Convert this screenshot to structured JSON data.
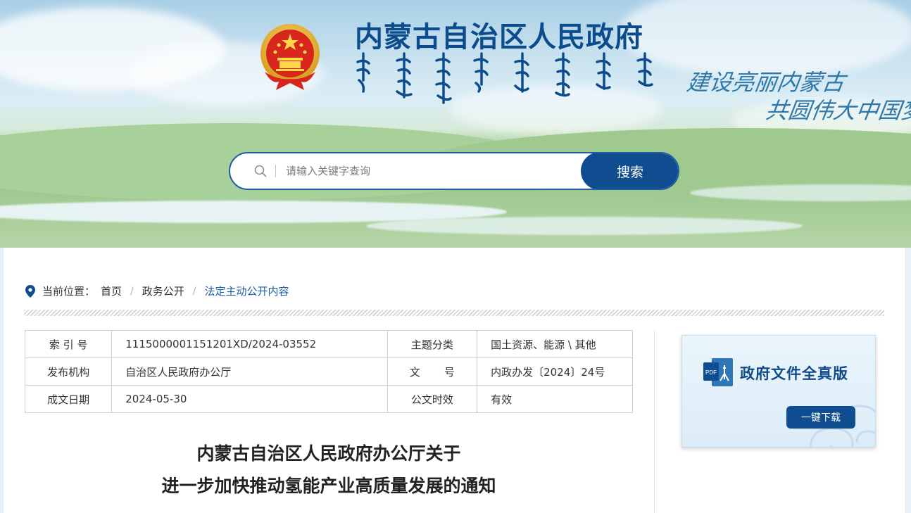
{
  "header": {
    "site_title": "内蒙古自治区人民政府",
    "slogan_line1": "建设亮丽内蒙古",
    "slogan_line2": "共圆伟大中国梦"
  },
  "search": {
    "placeholder": "请输入关键字查询",
    "button_label": "搜索"
  },
  "breadcrumb": {
    "prefix": "当前位置：",
    "items": [
      "首页",
      "政务公开",
      "法定主动公开内容"
    ],
    "separator": "/"
  },
  "meta": {
    "rows": [
      {
        "label1": "索 引 号",
        "value1": "1115000001151201XD/2024-03552",
        "label2": "主题分类",
        "value2": "国土资源、能源 \\ 其他"
      },
      {
        "label1": "发布机构",
        "value1": "自治区人民政府办公厅",
        "label2": "文 号",
        "value2": "内政办发〔2024〕24号"
      },
      {
        "label1": "成文日期",
        "value1": "2024-05-30",
        "label2": "公文时效",
        "value2": "有效"
      }
    ]
  },
  "pdf_panel": {
    "title": "政府文件全真版",
    "download_label": "一键下载"
  },
  "document": {
    "title_line1": "内蒙古自治区人民政府办公厅关于",
    "title_line2": "进一步加快推动氢能产业高质量发展的通知"
  },
  "colors": {
    "brand_blue": "#0f4c90",
    "link_blue": "#1d5ea3",
    "title_blue": "#0d4c8c"
  }
}
